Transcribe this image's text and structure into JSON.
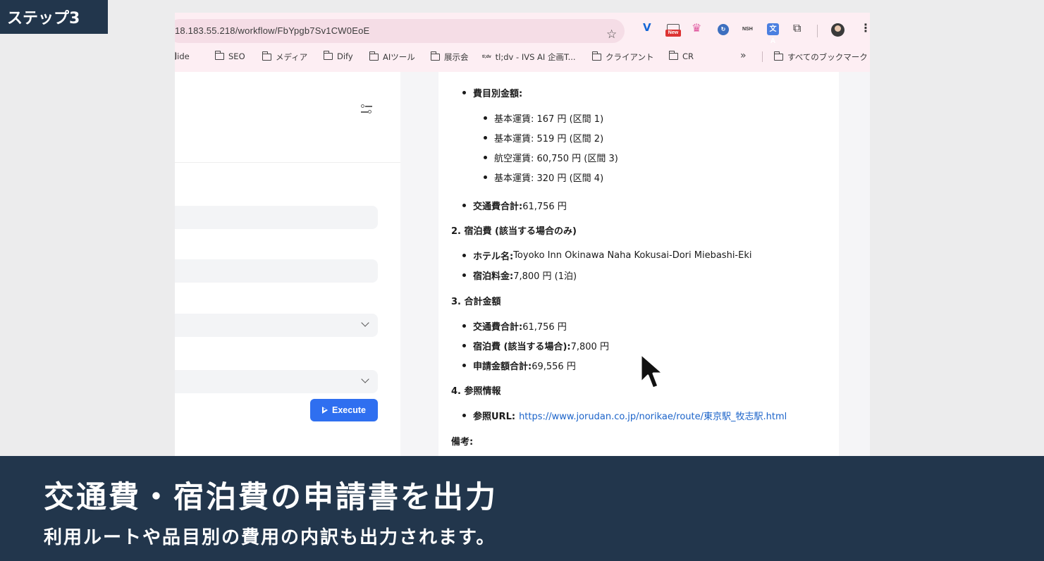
{
  "step_badge": "ステップ3",
  "browser": {
    "url": "18.183.55.218/workflow/FbYpgb7Sv1CW0EoE",
    "extensions": [
      "vimium-icon",
      "new-screen-icon",
      "crown-icon",
      "refresh-badge-icon",
      "nsh-icon",
      "translate-icon",
      "puzzle-icon"
    ],
    "ext_new_label": "New",
    "ext_nsh_label": "NSH",
    "ext_translate_label": "文A",
    "bookmarks": [
      "slide",
      "SEO",
      "メディア",
      "Dify",
      "AIツール",
      "展示会",
      "tl;dv - IVS AI 企画T...",
      "クライアント",
      "CR"
    ],
    "tldv_mark": "tl;dv",
    "more_bookmarks": "»",
    "all_bookmarks": "すべてのブックマーク"
  },
  "left_panel": {
    "execute_label": "Execute"
  },
  "doc": {
    "cost_by_item_label": "費目別金額:",
    "cost_items": [
      "基本運賃: 167 円 (区間 1)",
      "基本運賃: 519 円 (区間 2)",
      "航空運賃: 60,750 円 (区間 3)",
      "基本運賃: 320 円 (区間 4)"
    ],
    "transport_total_label": "交通費合計:",
    "transport_total_value": " 61,756 円",
    "section2": "2. 宿泊費 (該当する場合のみ)",
    "hotel_label": "ホテル名:",
    "hotel_value": " Toyoko Inn Okinawa Naha Kokusai-Dori Miebashi-Eki",
    "lodging_fee_label": "宿泊料金:",
    "lodging_fee_value": " 7,800 円 (1泊)",
    "section3": "3. 合計金額",
    "sum_transport_label": "交通費合計:",
    "sum_transport_value": " 61,756 円",
    "sum_lodging_label": "宿泊費 (該当する場合):",
    "sum_lodging_value": " 7,800 円",
    "sum_total_label": "申請金額合計:",
    "sum_total_value": " 69,556 円",
    "section4": "4. 参照情報",
    "ref_url_label": "参照URL:",
    "ref_url_value": "https://www.jorudan.co.jp/norikae/route/東京駅_牧志駅.html",
    "remarks_label": "備考:"
  },
  "caption": {
    "title": "交通費・宿泊費の申請書を出力",
    "subtitle": "利用ルートや品目別の費用の内訳も出力されます。"
  }
}
